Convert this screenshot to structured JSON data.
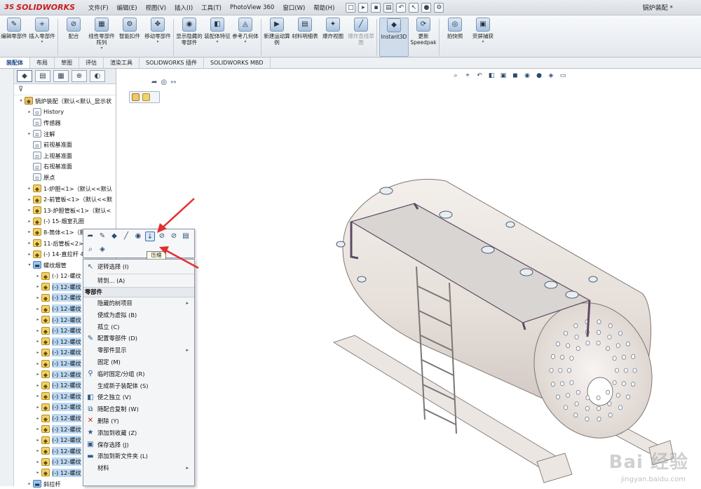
{
  "app": {
    "brand": "SOLIDWORKS",
    "brand_mark": "3S",
    "doc_title": "锅炉装配 *"
  },
  "menus": [
    "文件(F)",
    "编辑(E)",
    "视图(V)",
    "插入(I)",
    "工具(T)",
    "PhotoView 360",
    "窗口(W)",
    "帮助(H)"
  ],
  "ribbon": [
    {
      "label": "编辑零部件",
      "icon": "edit-component-icon"
    },
    {
      "label": "插入零部件",
      "icon": "insert-component-icon",
      "dropdown": true
    },
    {
      "label": "配合",
      "icon": "mate-icon"
    },
    {
      "label": "线性零部件阵列",
      "icon": "linear-pattern-icon",
      "dropdown": true
    },
    {
      "label": "智能扣件",
      "icon": "smart-fastener-icon"
    },
    {
      "label": "移动零部件",
      "icon": "move-component-icon",
      "dropdown": true
    },
    {
      "label": "显示隐藏的零部件",
      "icon": "show-hidden-icon"
    },
    {
      "label": "装配体特征",
      "icon": "assembly-feature-icon",
      "dropdown": true
    },
    {
      "label": "参考几何体",
      "icon": "reference-geometry-icon",
      "dropdown": true
    },
    {
      "label": "新建运动算例",
      "icon": "motion-study-icon"
    },
    {
      "label": "材料明细表",
      "icon": "bom-icon"
    },
    {
      "label": "爆炸视图",
      "icon": "exploded-view-icon"
    },
    {
      "label": "爆炸直线草图",
      "icon": "explode-line-icon",
      "disabled": true
    },
    {
      "label": "Instant3D",
      "icon": "instant3d-icon",
      "active": true
    },
    {
      "label": "更新Speedpak",
      "icon": "speedpak-icon"
    },
    {
      "label": "拍快照",
      "icon": "snapshot-icon"
    },
    {
      "label": "荧屏捕获",
      "icon": "screen-capture-icon",
      "dropdown": true
    }
  ],
  "tabs": [
    {
      "label": "装配体",
      "active": true
    },
    {
      "label": "布局"
    },
    {
      "label": "草图"
    },
    {
      "label": "评估"
    },
    {
      "label": "渲染工具"
    },
    {
      "label": "SOLIDWORKS 插件"
    },
    {
      "label": "SOLIDWORKS MBD"
    }
  ],
  "tree": [
    {
      "label": "锅炉装配（默认<默认_显示状",
      "icon": "asm",
      "indent": 0,
      "expander": "▾"
    },
    {
      "label": "History",
      "icon": "doc",
      "indent": 1,
      "expander": "▸"
    },
    {
      "label": "传感器",
      "icon": "doc",
      "indent": 1,
      "expander": ""
    },
    {
      "label": "注解",
      "icon": "doc",
      "indent": 1,
      "expander": "▸"
    },
    {
      "label": "前视基准面",
      "icon": "doc",
      "indent": 1,
      "expander": ""
    },
    {
      "label": "上视基准面",
      "icon": "doc",
      "indent": 1,
      "expander": ""
    },
    {
      "label": "右视基准面",
      "icon": "doc",
      "indent": 1,
      "expander": ""
    },
    {
      "label": "原点",
      "icon": "doc",
      "indent": 1,
      "expander": ""
    },
    {
      "label": "1-炉胆<1>（默认<<默认",
      "icon": "part",
      "indent": 1,
      "expander": "▸"
    },
    {
      "label": "2-前管板<1>（默认<<默",
      "icon": "part",
      "indent": 1,
      "expander": "▸"
    },
    {
      "label": "13-炉胆管板<1>（默认<",
      "icon": "part",
      "indent": 1,
      "expander": "▸"
    },
    {
      "label": "(-) 15-烟室孔圈",
      "icon": "part",
      "indent": 1,
      "expander": "▸"
    },
    {
      "label": "8-筒体<1>（默认",
      "icon": "part",
      "indent": 1,
      "expander": "▸"
    },
    {
      "label": "11-后管板<2>",
      "icon": "part",
      "indent": 1,
      "expander": "▸"
    },
    {
      "label": "(-) 14-直拉杆 4",
      "icon": "part",
      "indent": 1,
      "expander": "▸"
    },
    {
      "label": "螺纹烟管",
      "icon": "folder",
      "indent": 1,
      "expander": "▾"
    },
    {
      "label": "(-) 12-螺纹",
      "icon": "part",
      "indent": 2,
      "expander": "▸"
    },
    {
      "label": "(-) 12-螺纹",
      "icon": "part",
      "indent": 2,
      "expander": "▸",
      "selected": true
    },
    {
      "label": "(-) 12-螺纹",
      "icon": "part",
      "indent": 2,
      "expander": "▸",
      "selected": true
    },
    {
      "label": "(-) 12-螺纹",
      "icon": "part",
      "indent": 2,
      "expander": "▸",
      "selected": true
    },
    {
      "label": "(-) 12-螺纹",
      "icon": "part",
      "indent": 2,
      "expander": "▸",
      "selected": true
    },
    {
      "label": "(-) 12-螺纹",
      "icon": "part",
      "indent": 2,
      "expander": "▸",
      "selected": true
    },
    {
      "label": "(-) 12-螺纹",
      "icon": "part",
      "indent": 2,
      "expander": "▸",
      "selected": true
    },
    {
      "label": "(-) 12-螺纹",
      "icon": "part",
      "indent": 2,
      "expander": "▸",
      "selected": true
    },
    {
      "label": "(-) 12-螺纹",
      "icon": "part",
      "indent": 2,
      "expander": "▸",
      "selected": true
    },
    {
      "label": "(-) 12-螺纹",
      "icon": "part",
      "indent": 2,
      "expander": "▸",
      "selected": true
    },
    {
      "label": "(-) 12-螺纹",
      "icon": "part",
      "indent": 2,
      "expander": "▸",
      "selected": true
    },
    {
      "label": "(-) 12-螺纹",
      "icon": "part",
      "indent": 2,
      "expander": "▸",
      "selected": true
    },
    {
      "label": "(-) 12-螺纹",
      "icon": "part",
      "indent": 2,
      "expander": "▸",
      "selected": true
    },
    {
      "label": "(-) 12-螺纹",
      "icon": "part",
      "indent": 2,
      "expander": "▸",
      "selected": true
    },
    {
      "label": "(-) 12-螺纹",
      "icon": "part",
      "indent": 2,
      "expander": "▸",
      "selected": true
    },
    {
      "label": "(-) 12-螺纹",
      "icon": "part",
      "indent": 2,
      "expander": "▸",
      "selected": true
    },
    {
      "label": "(-) 12-螺纹",
      "icon": "part",
      "indent": 2,
      "expander": "▸",
      "selected": true
    },
    {
      "label": "(-) 12-螺纹",
      "icon": "part",
      "indent": 2,
      "expander": "▸",
      "selected": true
    },
    {
      "label": "(-) 12-螺纹",
      "icon": "part",
      "indent": 2,
      "expander": "▸",
      "selected": true
    },
    {
      "label": "斜拉杆",
      "icon": "folder",
      "indent": 1,
      "expander": "▸"
    }
  ],
  "context_toolbar": {
    "tooltip": "压缩"
  },
  "context_menu": [
    {
      "label": "逆转选择 (I)",
      "icon": "invert-select-icon"
    },
    {
      "sep": true
    },
    {
      "label": "转到... (A)",
      "icon": ""
    },
    {
      "header": "零部件"
    },
    {
      "label": "隐藏的树项目",
      "icon": "",
      "submenu": true
    },
    {
      "label": "使成为虚拟 (B)",
      "icon": ""
    },
    {
      "label": "孤立 (C)",
      "icon": ""
    },
    {
      "label": "配置零部件 (D)",
      "icon": "configure-icon"
    },
    {
      "label": "零部件显示",
      "icon": "",
      "submenu": true
    },
    {
      "label": "固定 (M)",
      "icon": ""
    },
    {
      "label": "临时固定/分组 (R)",
      "icon": "temp-fix-icon"
    },
    {
      "label": "生成新子装配体 (S)",
      "icon": ""
    },
    {
      "label": "使之独立 (V)",
      "icon": "make-independent-icon"
    },
    {
      "label": "随配合复制 (W)",
      "icon": "copy-with-mates-icon"
    },
    {
      "label": "删除 (Y)",
      "icon": "delete-icon"
    },
    {
      "label": "添加到收藏 (Z)",
      "icon": "favorite-icon"
    },
    {
      "label": "保存选择 (J)",
      "icon": "save-selection-icon"
    },
    {
      "label": "添加到新文件夹 (L)",
      "icon": "new-folder-icon"
    },
    {
      "label": "材料",
      "icon": "",
      "submenu": true
    }
  ],
  "watermark": {
    "brand": "Bai 经验",
    "url": "jingyan.baidu.com"
  },
  "colors": {
    "accent": "#1f4a86",
    "arrow": "#e03030",
    "brand": "#c81e1e",
    "selection": "#bcd8f3"
  }
}
